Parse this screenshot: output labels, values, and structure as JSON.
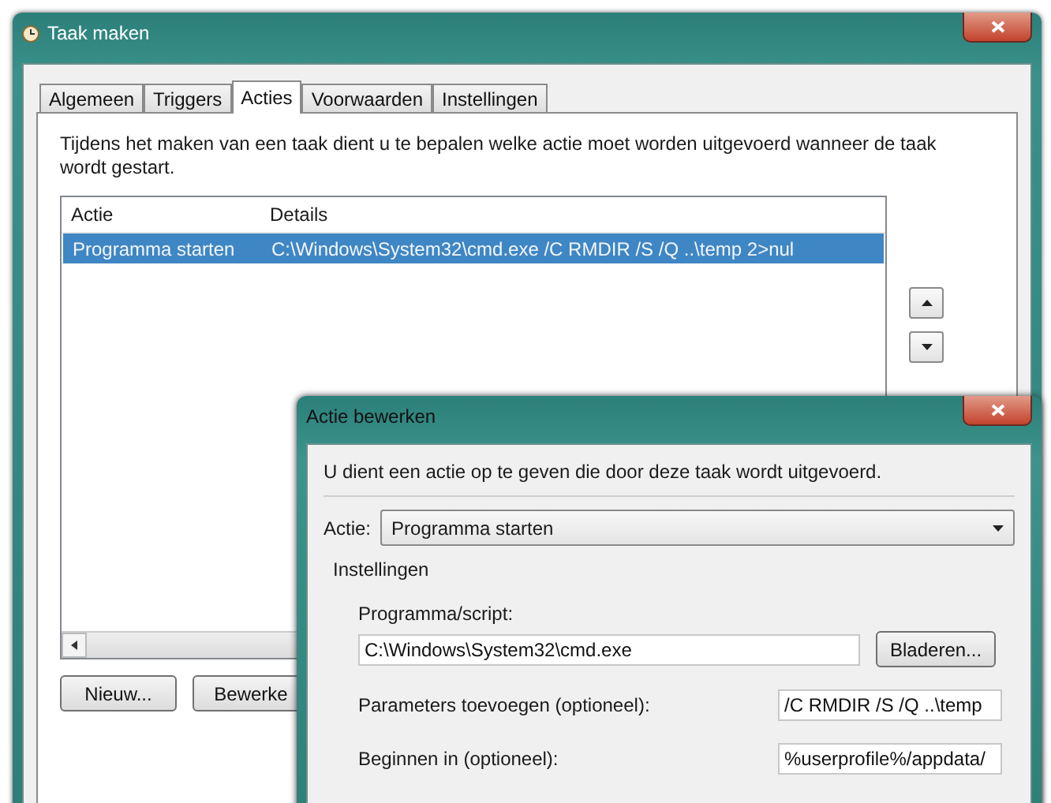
{
  "window": {
    "title": "Taak maken"
  },
  "tabs": [
    {
      "label": "Algemeen",
      "selected": false
    },
    {
      "label": "Triggers",
      "selected": false
    },
    {
      "label": "Acties",
      "selected": true
    },
    {
      "label": "Voorwaarden",
      "selected": false
    },
    {
      "label": "Instellingen",
      "selected": false
    }
  ],
  "description": "Tijdens het maken van een taak dient u te bepalen welke actie moet worden uitgevoerd wanneer de taak wordt gestart.",
  "table": {
    "columns": [
      "Actie",
      "Details"
    ],
    "rows": [
      {
        "cells": [
          "Programma starten",
          "C:\\Windows\\System32\\cmd.exe /C RMDIR /S /Q ..\\temp 2>nul"
        ],
        "selected": true
      }
    ]
  },
  "buttons": [
    "Nieuw...",
    "Bewerke"
  ],
  "dialog": {
    "title": "Actie bewerken",
    "instruction": "U dient een actie op te geven die door deze taak wordt uitgevoerd.",
    "action_label": "Actie:",
    "action_value": "Programma starten",
    "settings_label": "Instellingen",
    "fields": [
      {
        "label": "Programma/script:",
        "value": "C:\\Windows\\System32\\cmd.exe",
        "button": "Bladeren..."
      },
      {
        "label": "Parameters toevoegen (optioneel):",
        "value": "/C RMDIR /S /Q ..\\temp"
      },
      {
        "label": "Beginnen in (optioneel):",
        "value": "%userprofile%/appdata/"
      }
    ]
  }
}
